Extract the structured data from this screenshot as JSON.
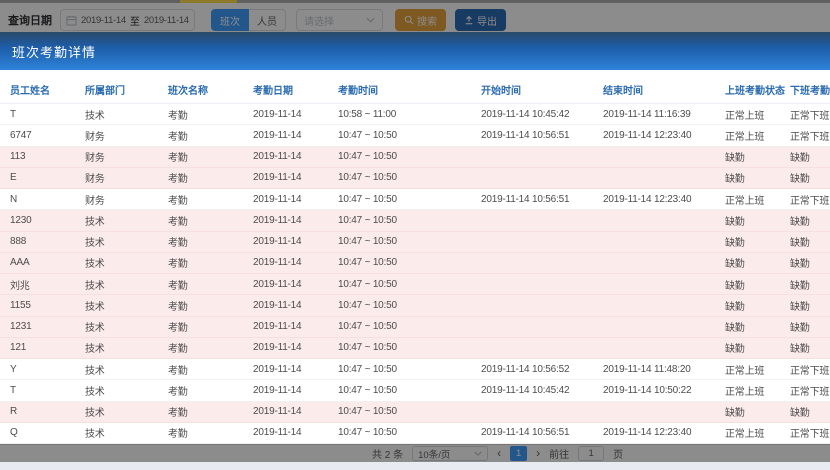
{
  "colors": {
    "primary": "#409EFF",
    "warning": "#E6A23C",
    "export_blue": "#2d6cb5",
    "header_gradient_top": "#2b4a68",
    "header_gradient_bottom": "#2e82d9",
    "header_text": "#2b6cb0",
    "absent_row_bg": "#fcebeb"
  },
  "toolbar": {
    "query_label": "查询日期",
    "date_from": "2019-11-14",
    "date_separator": "至",
    "date_to": "2019-11-14",
    "tab_shift": "班次",
    "tab_person": "人员",
    "select_placeholder": "请选择",
    "search_label": "搜索",
    "export_label": "导出"
  },
  "panel": {
    "title": "班次考勤详情"
  },
  "table": {
    "headers": [
      "员工姓名",
      "所属部门",
      "班次名称",
      "考勤日期",
      "考勤时间",
      "开始时间",
      "结束时间",
      "上班考勤状态",
      "下班考勤状态"
    ],
    "rows": [
      {
        "name": "T",
        "dept": "技术",
        "shift": "考勤",
        "date": "2019-11-14",
        "time": "10:58 ~ 11:00",
        "start": "2019-11-14 10:45:42",
        "end": "2019-11-14 11:16:39",
        "status_in": "正常上班",
        "status_out": "正常下班",
        "absent": false
      },
      {
        "name": "6747",
        "dept": "财务",
        "shift": "考勤",
        "date": "2019-11-14",
        "time": "10:47 ~ 10:50",
        "start": "2019-11-14 10:56:51",
        "end": "2019-11-14 12:23:40",
        "status_in": "正常上班",
        "status_out": "正常下班",
        "absent": false
      },
      {
        "name": "113",
        "dept": "财务",
        "shift": "考勤",
        "date": "2019-11-14",
        "time": "10:47 ~ 10:50",
        "start": "",
        "end": "",
        "status_in": "缺勤",
        "status_out": "缺勤",
        "absent": true
      },
      {
        "name": "E",
        "dept": "财务",
        "shift": "考勤",
        "date": "2019-11-14",
        "time": "10:47 ~ 10:50",
        "start": "",
        "end": "",
        "status_in": "缺勤",
        "status_out": "缺勤",
        "absent": true
      },
      {
        "name": "N",
        "dept": "财务",
        "shift": "考勤",
        "date": "2019-11-14",
        "time": "10:47 ~ 10:50",
        "start": "2019-11-14 10:56:51",
        "end": "2019-11-14 12:23:40",
        "status_in": "正常上班",
        "status_out": "正常下班",
        "absent": false
      },
      {
        "name": "1230",
        "dept": "技术",
        "shift": "考勤",
        "date": "2019-11-14",
        "time": "10:47 ~ 10:50",
        "start": "",
        "end": "",
        "status_in": "缺勤",
        "status_out": "缺勤",
        "absent": true
      },
      {
        "name": "888",
        "dept": "技术",
        "shift": "考勤",
        "date": "2019-11-14",
        "time": "10:47 ~ 10:50",
        "start": "",
        "end": "",
        "status_in": "缺勤",
        "status_out": "缺勤",
        "absent": true
      },
      {
        "name": "AAA",
        "dept": "技术",
        "shift": "考勤",
        "date": "2019-11-14",
        "time": "10:47 ~ 10:50",
        "start": "",
        "end": "",
        "status_in": "缺勤",
        "status_out": "缺勤",
        "absent": true
      },
      {
        "name": "刘兆",
        "dept": "技术",
        "shift": "考勤",
        "date": "2019-11-14",
        "time": "10:47 ~ 10:50",
        "start": "",
        "end": "",
        "status_in": "缺勤",
        "status_out": "缺勤",
        "absent": true
      },
      {
        "name": "1155",
        "dept": "技术",
        "shift": "考勤",
        "date": "2019-11-14",
        "time": "10:47 ~ 10:50",
        "start": "",
        "end": "",
        "status_in": "缺勤",
        "status_out": "缺勤",
        "absent": true
      },
      {
        "name": "1231",
        "dept": "技术",
        "shift": "考勤",
        "date": "2019-11-14",
        "time": "10:47 ~ 10:50",
        "start": "",
        "end": "",
        "status_in": "缺勤",
        "status_out": "缺勤",
        "absent": true
      },
      {
        "name": "121",
        "dept": "技术",
        "shift": "考勤",
        "date": "2019-11-14",
        "time": "10:47 ~ 10:50",
        "start": "",
        "end": "",
        "status_in": "缺勤",
        "status_out": "缺勤",
        "absent": true
      },
      {
        "name": "Y",
        "dept": "技术",
        "shift": "考勤",
        "date": "2019-11-14",
        "time": "10:47 ~ 10:50",
        "start": "2019-11-14 10:56:52",
        "end": "2019-11-14 11:48:20",
        "status_in": "正常上班",
        "status_out": "正常下班",
        "absent": false
      },
      {
        "name": "T",
        "dept": "技术",
        "shift": "考勤",
        "date": "2019-11-14",
        "time": "10:47 ~ 10:50",
        "start": "2019-11-14 10:45:42",
        "end": "2019-11-14 10:50:22",
        "status_in": "正常上班",
        "status_out": "正常下班",
        "absent": false
      },
      {
        "name": "R",
        "dept": "技术",
        "shift": "考勤",
        "date": "2019-11-14",
        "time": "10:47 ~ 10:50",
        "start": "",
        "end": "",
        "status_in": "缺勤",
        "status_out": "缺勤",
        "absent": true
      },
      {
        "name": "Q",
        "dept": "技术",
        "shift": "考勤",
        "date": "2019-11-14",
        "time": "10:47 ~ 10:50",
        "start": "2019-11-14 10:56:51",
        "end": "2019-11-14 12:23:40",
        "status_in": "正常上班",
        "status_out": "正常下班",
        "absent": false
      }
    ]
  },
  "pagination": {
    "total": "共 2 条",
    "page_size": "10条/页",
    "prev_icon": "‹",
    "current_page": "1",
    "next_icon": "›",
    "goto_label": "前往",
    "goto_value": "1",
    "page_unit": "页"
  }
}
